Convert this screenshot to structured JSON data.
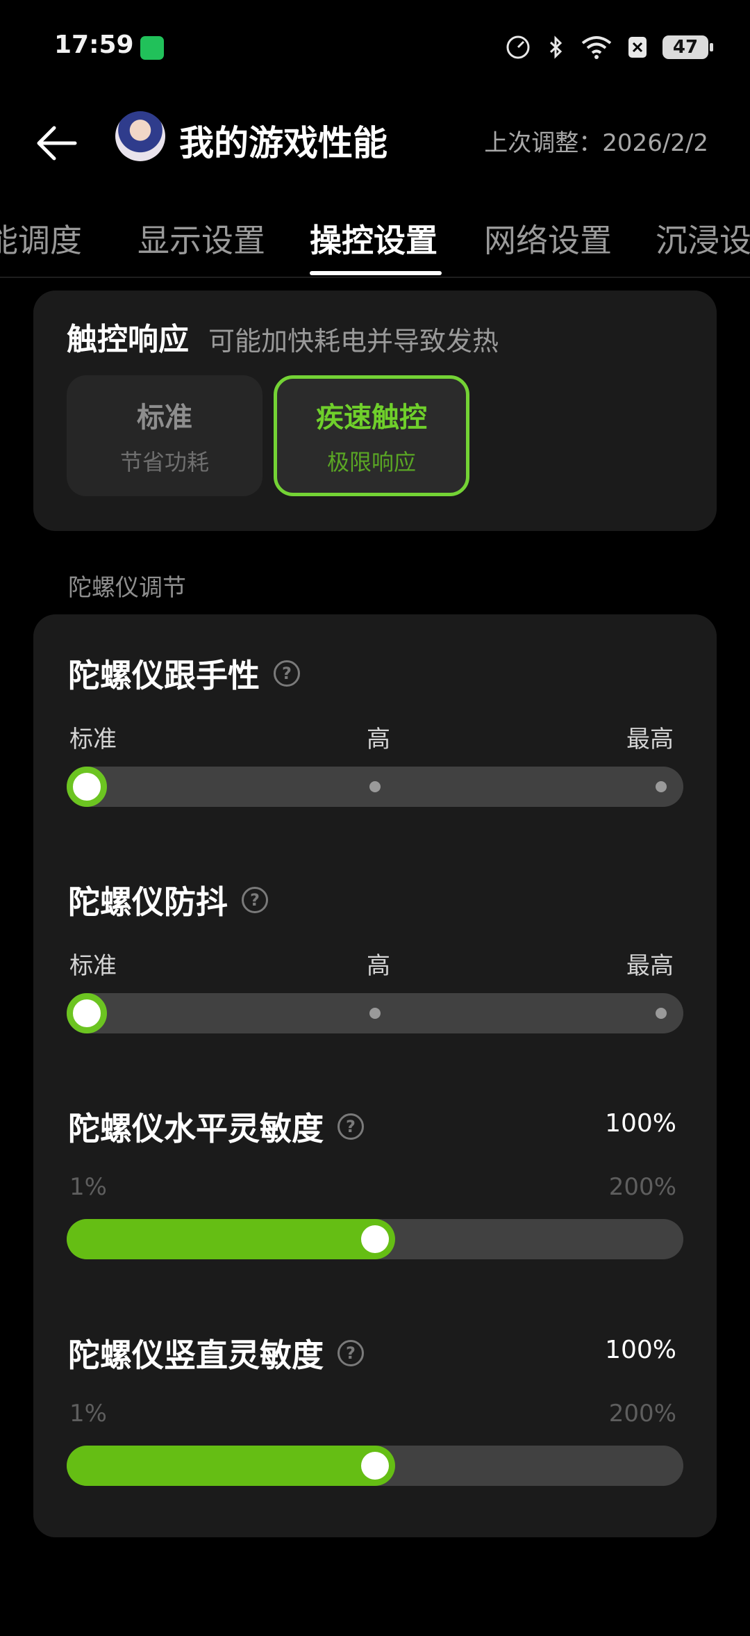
{
  "status_bar": {
    "time": "17:59",
    "battery": "47"
  },
  "header": {
    "title": "我的游戏性能",
    "last_adjust": "上次调整：2026/2/2"
  },
  "tabs": [
    {
      "label": "能调度"
    },
    {
      "label": "显示设置"
    },
    {
      "label": "操控设置",
      "active": true
    },
    {
      "label": "网络设置"
    },
    {
      "label": "沉浸设"
    }
  ],
  "touch": {
    "title": "触控响应",
    "subtitle": "可能加快耗电并导致发热",
    "options": [
      {
        "title": "标准",
        "subtitle": "节省功耗",
        "selected": false
      },
      {
        "title": "疾速触控",
        "subtitle": "极限响应",
        "selected": true
      }
    ]
  },
  "gyro_section_label": "陀螺仪调节",
  "gyro": {
    "follow": {
      "title": "陀螺仪跟手性",
      "levels": [
        "标准",
        "高",
        "最高"
      ],
      "selected_level": 0
    },
    "shake": {
      "title": "陀螺仪防抖",
      "levels": [
        "标准",
        "高",
        "最高"
      ],
      "selected_level": 0
    },
    "horizontal": {
      "title": "陀螺仪水平灵敏度",
      "value_text": "100%",
      "min_label": "1%",
      "max_label": "200%",
      "fraction": 0.5
    },
    "vertical": {
      "title": "陀螺仪竖直灵敏度",
      "value_text": "100%",
      "min_label": "1%",
      "max_label": "200%",
      "fraction": 0.5
    }
  },
  "colors": {
    "accent": "#6cc421",
    "card": "#1b1b1b",
    "track": "#414141"
  }
}
